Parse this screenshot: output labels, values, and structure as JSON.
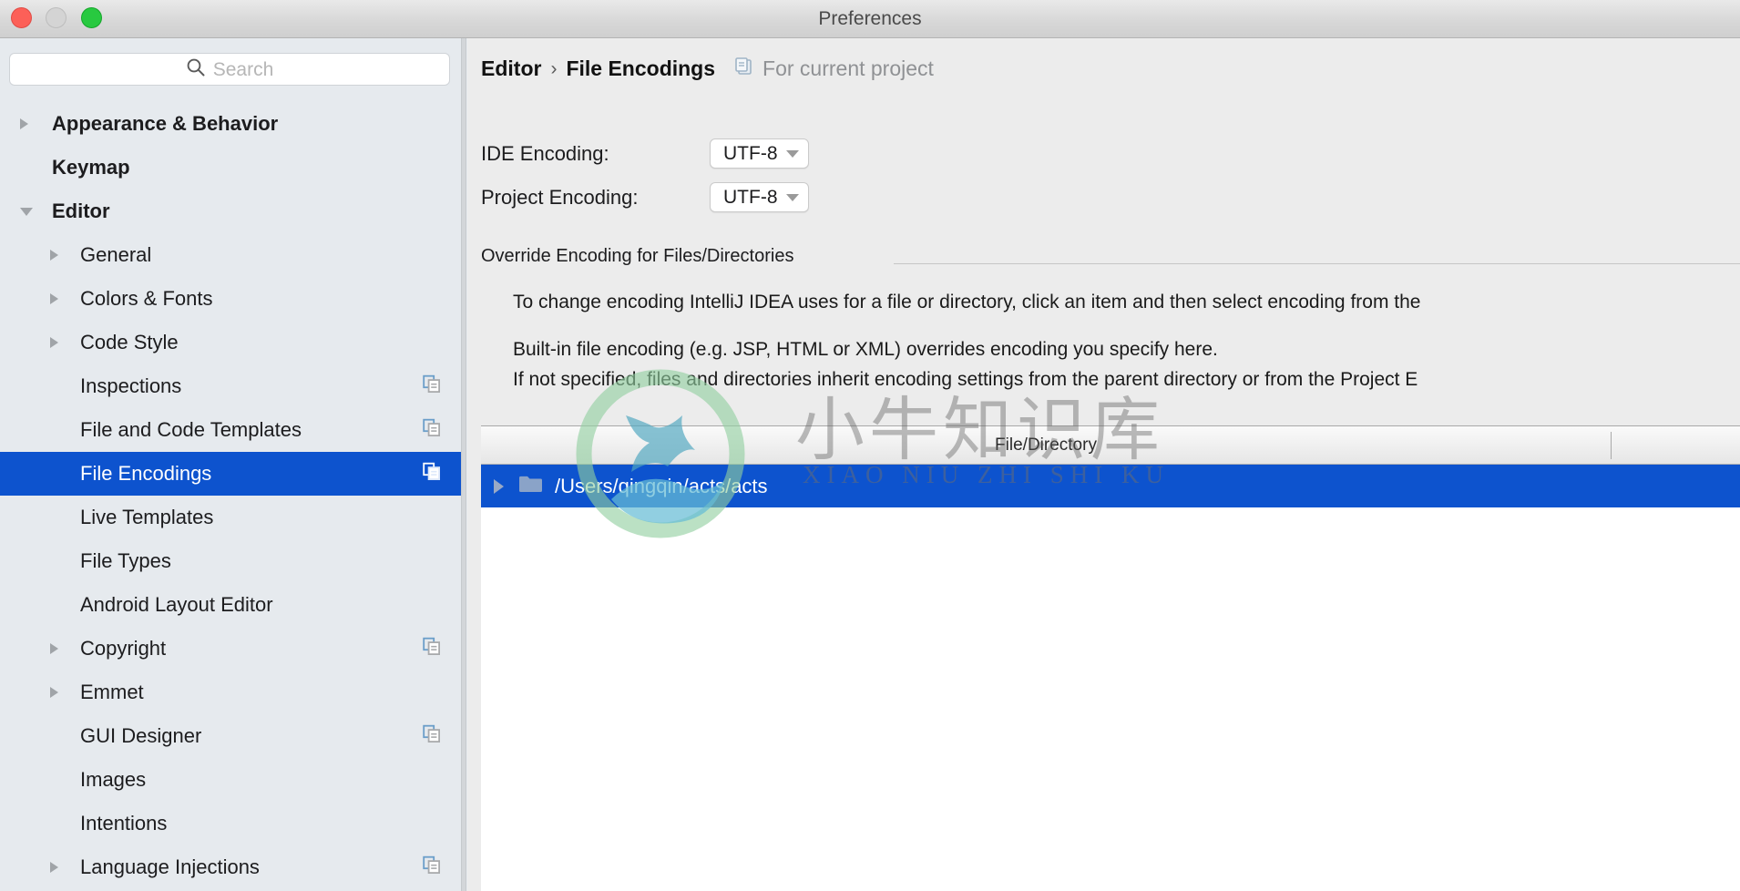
{
  "window": {
    "title": "Preferences",
    "controls": [
      {
        "name": "close",
        "color": "#fc6058"
      },
      {
        "name": "minimize",
        "color": "#d4d4d4"
      },
      {
        "name": "maximize",
        "color": "#28c940"
      }
    ]
  },
  "search": {
    "placeholder": "Search",
    "value": "",
    "icon": "search-icon"
  },
  "sidebar": {
    "items": [
      {
        "label": "Appearance & Behavior",
        "depth": 0,
        "arrow": "collapsed",
        "bold": true,
        "copy": false,
        "selected": false
      },
      {
        "label": "Keymap",
        "depth": 0,
        "arrow": "none",
        "bold": true,
        "copy": false,
        "selected": false
      },
      {
        "label": "Editor",
        "depth": 0,
        "arrow": "expanded",
        "bold": true,
        "copy": false,
        "selected": false
      },
      {
        "label": "General",
        "depth": 1,
        "arrow": "collapsed",
        "bold": false,
        "copy": false,
        "selected": false
      },
      {
        "label": "Colors & Fonts",
        "depth": 1,
        "arrow": "collapsed",
        "bold": false,
        "copy": false,
        "selected": false
      },
      {
        "label": "Code Style",
        "depth": 1,
        "arrow": "collapsed",
        "bold": false,
        "copy": false,
        "selected": false
      },
      {
        "label": "Inspections",
        "depth": 1,
        "arrow": "none",
        "bold": false,
        "copy": true,
        "selected": false
      },
      {
        "label": "File and Code Templates",
        "depth": 1,
        "arrow": "none",
        "bold": false,
        "copy": true,
        "selected": false
      },
      {
        "label": "File Encodings",
        "depth": 1,
        "arrow": "none",
        "bold": false,
        "copy": true,
        "selected": true
      },
      {
        "label": "Live Templates",
        "depth": 1,
        "arrow": "none",
        "bold": false,
        "copy": false,
        "selected": false
      },
      {
        "label": "File Types",
        "depth": 1,
        "arrow": "none",
        "bold": false,
        "copy": false,
        "selected": false
      },
      {
        "label": "Android Layout Editor",
        "depth": 1,
        "arrow": "none",
        "bold": false,
        "copy": false,
        "selected": false
      },
      {
        "label": "Copyright",
        "depth": 1,
        "arrow": "collapsed",
        "bold": false,
        "copy": true,
        "selected": false
      },
      {
        "label": "Emmet",
        "depth": 1,
        "arrow": "collapsed",
        "bold": false,
        "copy": false,
        "selected": false
      },
      {
        "label": "GUI Designer",
        "depth": 1,
        "arrow": "none",
        "bold": false,
        "copy": true,
        "selected": false
      },
      {
        "label": "Images",
        "depth": 1,
        "arrow": "none",
        "bold": false,
        "copy": false,
        "selected": false
      },
      {
        "label": "Intentions",
        "depth": 1,
        "arrow": "none",
        "bold": false,
        "copy": false,
        "selected": false
      },
      {
        "label": "Language Injections",
        "depth": 1,
        "arrow": "collapsed",
        "bold": false,
        "copy": true,
        "selected": false
      }
    ]
  },
  "main": {
    "breadcrumb": {
      "parent": "Editor",
      "separator": "›",
      "current": "File Encodings",
      "scope_icon": "project-scope-icon",
      "scope": "For current project"
    },
    "ide_encoding": {
      "label": "IDE Encoding:",
      "value": "UTF-8"
    },
    "project_encoding": {
      "label": "Project Encoding:",
      "value": "UTF-8"
    },
    "override_section": {
      "title": "Override Encoding for Files/Directories",
      "lines": [
        "To change encoding IntelliJ IDEA uses for a file or directory, click an item and then select encoding from the",
        "Built-in file encoding (e.g. JSP, HTML or XML) overrides encoding you specify here.",
        "If not specified, files and directories inherit encoding settings from the parent directory or from the Project E"
      ]
    },
    "table": {
      "columns": [
        "File/Directory"
      ],
      "rows": [
        {
          "path": "/Users/qingqin/acts/acts",
          "selected": true,
          "expandable": true,
          "icon": "folder-icon"
        }
      ]
    }
  },
  "watermark": {
    "cn": "小牛知识库",
    "en": "XIAO NIU ZHI SHI KU"
  },
  "colors": {
    "selection": "#0d53ce",
    "sidebar_bg": "#e6eaee",
    "main_bg": "#ececec",
    "accent_copy_icon": "#6a9ec9"
  }
}
